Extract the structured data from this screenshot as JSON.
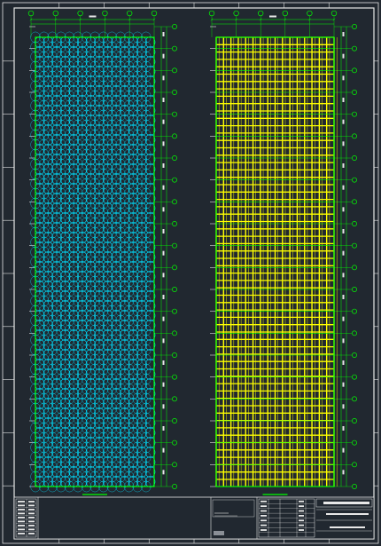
{
  "viewer": {
    "background": "#212830",
    "frame_color": "#ffffff",
    "ticks_top": 8,
    "ticks_side": 10
  },
  "plans": [
    {
      "id": "left",
      "pattern": "circles",
      "grid_color": "#00ff00",
      "mesh_color": "#00e0ff",
      "columns": 6,
      "rows": 21,
      "title_bar_color": "#00ff00"
    },
    {
      "id": "right",
      "pattern": "grid",
      "grid_color": "#00ff00",
      "mesh_color": "#ffff00",
      "columns": 6,
      "rows": 21,
      "title_bar_color": "#00ff00"
    }
  ],
  "title_block": {
    "notes": [
      "",
      "",
      "",
      "",
      "",
      "",
      "",
      "",
      ""
    ],
    "info_lines": [
      "",
      "",
      ""
    ]
  }
}
